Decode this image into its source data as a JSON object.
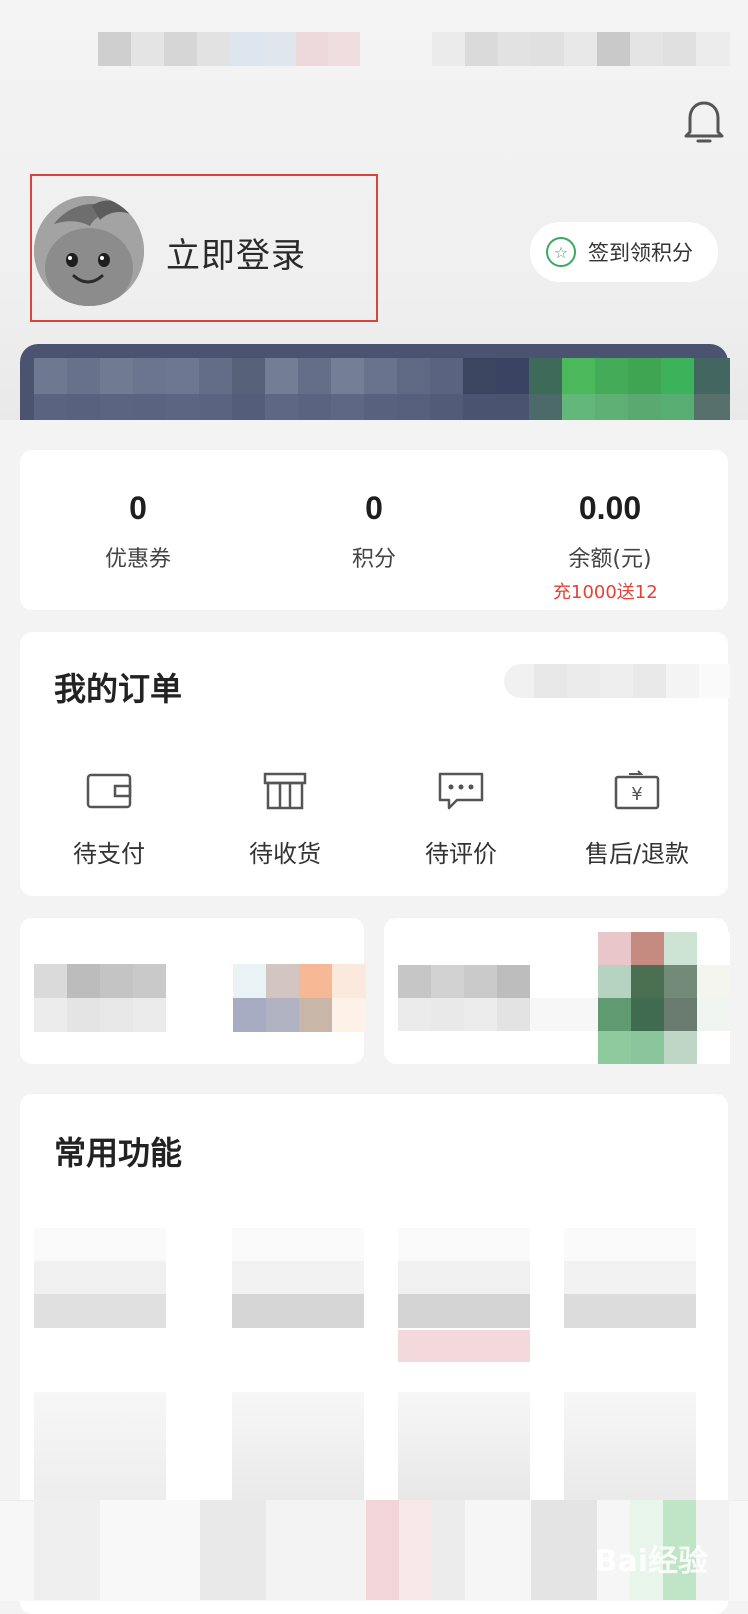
{
  "header": {
    "login_text": "立即登录",
    "signin_label": "签到领积分"
  },
  "icons": {
    "bell": "bell-icon",
    "signin": "star-circle-icon",
    "avatar": "avatar-mascot"
  },
  "stats": [
    {
      "value": "0",
      "label": "优惠券"
    },
    {
      "value": "0",
      "label": "积分"
    },
    {
      "value": "0.00",
      "label": "余额(元)"
    }
  ],
  "stats_promo": "充1000送12",
  "orders": {
    "title": "我的订单",
    "items": [
      {
        "label": "待支付",
        "icon": "wallet-icon"
      },
      {
        "label": "待收货",
        "icon": "package-icon"
      },
      {
        "label": "待评价",
        "icon": "comment-icon"
      },
      {
        "label": "售后/退款",
        "icon": "refund-icon"
      }
    ]
  },
  "functions": {
    "title": "常用功能"
  },
  "watermark": "Bai经验",
  "colors": {
    "accent_green": "#3aa864",
    "promo_red": "#e2423a",
    "highlight_border": "#d9443e"
  }
}
